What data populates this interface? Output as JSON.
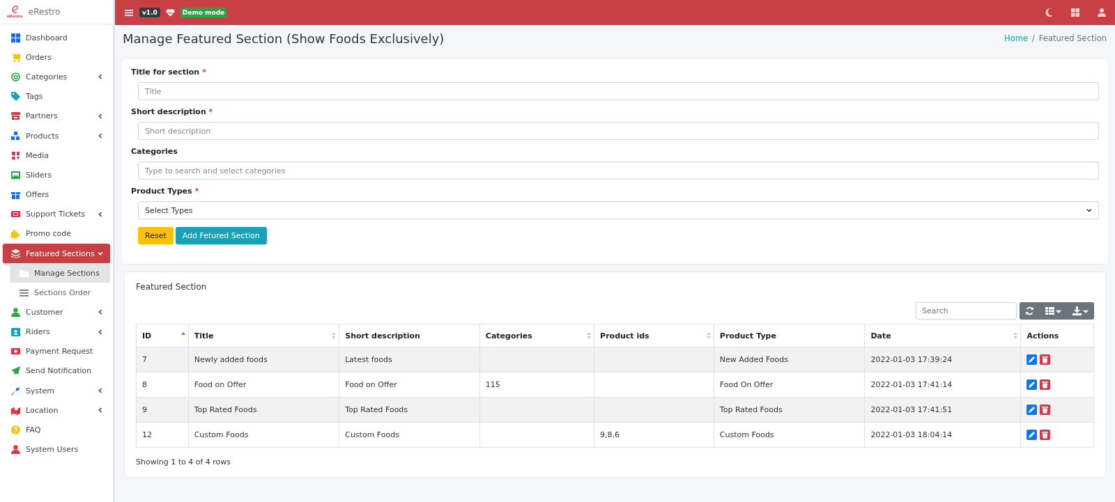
{
  "brand": {
    "logo_text": "eRestro",
    "name": "eRestro"
  },
  "topbar": {
    "version": "v1.0",
    "demo_badge": "Demo mode"
  },
  "sidebar": {
    "items": [
      {
        "label": "Dashboard",
        "has_submenu": false,
        "selected": false
      },
      {
        "label": "Orders",
        "has_submenu": false,
        "selected": false
      },
      {
        "label": "Categories",
        "has_submenu": true,
        "selected": false
      },
      {
        "label": "Tags",
        "has_submenu": false,
        "selected": false
      },
      {
        "label": "Partners",
        "has_submenu": true,
        "selected": false
      },
      {
        "label": "Products",
        "has_submenu": true,
        "selected": false
      },
      {
        "label": "Media",
        "has_submenu": false,
        "selected": false
      },
      {
        "label": "Sliders",
        "has_submenu": false,
        "selected": false
      },
      {
        "label": "Offers",
        "has_submenu": false,
        "selected": false
      },
      {
        "label": "Support Tickets",
        "has_submenu": true,
        "selected": false
      },
      {
        "label": "Promo code",
        "has_submenu": false,
        "selected": false
      },
      {
        "label": "Featured Sections",
        "has_submenu": true,
        "selected": true,
        "expanded": true,
        "children": [
          {
            "label": "Manage Sections",
            "selected": true
          },
          {
            "label": "Sections Order",
            "selected": false
          }
        ]
      },
      {
        "label": "Customer",
        "has_submenu": true,
        "selected": false
      },
      {
        "label": "Riders",
        "has_submenu": true,
        "selected": false
      },
      {
        "label": "Payment Request",
        "has_submenu": false,
        "selected": false
      },
      {
        "label": "Send Notification",
        "has_submenu": false,
        "selected": false
      },
      {
        "label": "System",
        "has_submenu": true,
        "selected": false
      },
      {
        "label": "Location",
        "has_submenu": true,
        "selected": false
      },
      {
        "label": "FAQ",
        "has_submenu": false,
        "selected": false
      },
      {
        "label": "System Users",
        "has_submenu": false,
        "selected": false
      }
    ]
  },
  "page": {
    "title": "Manage Featured Section (Show Foods Exclusively)",
    "breadcrumb": [
      "Home",
      "Featured Section"
    ],
    "breadcrumb_separator": "/"
  },
  "form": {
    "required_mark": "*",
    "fields": [
      {
        "kind": "input",
        "label": "Title for section",
        "required": true,
        "placeholder": "Title"
      },
      {
        "kind": "input",
        "label": "Short description",
        "required": true,
        "placeholder": "Short description"
      },
      {
        "kind": "input",
        "label": "Categories",
        "required": false,
        "placeholder": "Type to search and select categories"
      },
      {
        "kind": "select",
        "label": "Product Types",
        "required": true,
        "value": "Select Types"
      }
    ],
    "buttons": [
      {
        "kind": "warning",
        "label": "Reset"
      },
      {
        "kind": "info",
        "label": "Add Fetured Section"
      }
    ]
  },
  "table_card": {
    "title": "Featured Section",
    "search": {
      "placeholder": "Search"
    },
    "columns": [
      {
        "label": "ID",
        "sortable": true,
        "sorted": true
      },
      {
        "label": "Title",
        "sortable": true,
        "sorted": false
      },
      {
        "label": "Short description",
        "sortable": false,
        "sorted": false
      },
      {
        "label": "Categories",
        "sortable": true,
        "sorted": false
      },
      {
        "label": "Product ids",
        "sortable": true,
        "sorted": false
      },
      {
        "label": "Product Type",
        "sortable": false,
        "sorted": false
      },
      {
        "label": "Date",
        "sortable": true,
        "sorted": false
      },
      {
        "label": "Actions",
        "sortable": false,
        "sorted": false
      }
    ],
    "rows": [
      {
        "cells": [
          "7",
          "Newly added foods",
          "Latest foods",
          "",
          "",
          "New Added Foods",
          "2022-01-03 17:39:24"
        ]
      },
      {
        "cells": [
          "8",
          "Food on Offer",
          "Food on Offer",
          "115",
          "",
          "Food On Offer",
          "2022-01-03 17:41:14"
        ]
      },
      {
        "cells": [
          "9",
          "Top Rated Foods",
          "Top Rated Foods",
          "",
          "",
          "Top Rated Foods",
          "2022-01-03 17:41:51"
        ]
      },
      {
        "cells": [
          "12",
          "Custom Foods",
          "Custom Foods",
          "",
          "9,8,6",
          "Custom Foods",
          "2022-01-03 18:04:14"
        ]
      }
    ],
    "footer": "Showing 1 to 4 of 4 rows"
  }
}
